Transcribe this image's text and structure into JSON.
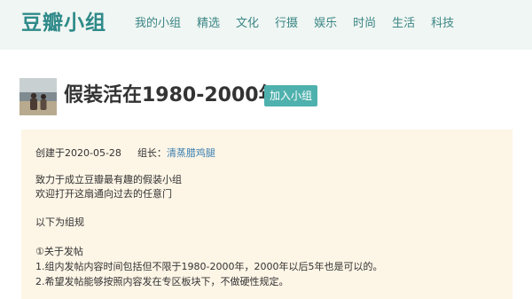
{
  "nav": {
    "logo": "豆瓣小组",
    "items": [
      "我的小组",
      "精选",
      "文化",
      "行摄",
      "娱乐",
      "时尚",
      "生活",
      "科技"
    ]
  },
  "group": {
    "title": "假装活在1980-2000年",
    "join_label": "加入小组",
    "created_label": "创建于2020-05-28",
    "owner_label": "组长：",
    "owner_name": "清蒸腊鸡腿",
    "description": [
      "致力于成立豆瓣最有趣的假装小组",
      "欢迎打开这扇通向过去的任意门",
      "以下为组规",
      "①关于发帖",
      "1.组内发帖内容时间包括但不限于1980-2000年，2000年以后5年也是可以的。",
      "2.希望发帖能够按照内容发在专区板块下，不做硬性规定。"
    ]
  },
  "colors": {
    "brand": "#2e8a89",
    "nav_bg": "#f0f6f3",
    "button_bg": "#4fb1ad",
    "card_bg": "#fdf5e6",
    "link": "#3a7fb0"
  }
}
